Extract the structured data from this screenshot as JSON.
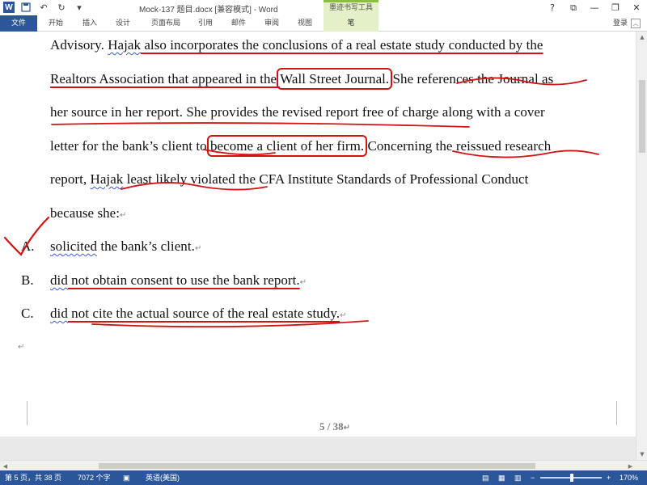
{
  "window": {
    "title": "Mock-137 题目.docx [兼容模式] - Word",
    "context_tool_title": "墨迹书写工具",
    "help": "?",
    "ribbon_display": "⧉",
    "minimize": "—",
    "restore": "❐",
    "close": "✕"
  },
  "ribbon": {
    "tabs": [
      "文件",
      "开始",
      "插入",
      "设计",
      "页面布局",
      "引用",
      "邮件",
      "审阅",
      "视图",
      "笔"
    ],
    "login": "登录",
    "collapse": "︿"
  },
  "document": {
    "lines": [
      [
        "Advisory. ",
        "Hajak",
        " also incorporates the conclusions of a real estate study conducted by the"
      ],
      [
        "Realtors Association that appeared in the ",
        "Wall Street Journal.",
        " She references the Journal as"
      ],
      [
        "her source in her report. She provides the revised report free of charge along with a cover"
      ],
      [
        "letter for the bank’s client to ",
        "become a client of her firm.",
        " Concerning the reissued research"
      ],
      [
        "report, ",
        "Hajak",
        " least likely violated the CFA Institute Standards of Professional Conduct"
      ],
      [
        "because she:"
      ]
    ],
    "para_mark": "↵",
    "options": [
      {
        "letter": "A.",
        "parts": [
          "solicited",
          " the bank’s client."
        ]
      },
      {
        "letter": "B.",
        "parts": [
          "did",
          " not obtain consent to use the bank report."
        ]
      },
      {
        "letter": "C.",
        "parts": [
          "did",
          " not cite the actual source of the real estate study."
        ]
      }
    ],
    "page_number": "5 / 38"
  },
  "status": {
    "page": "第 5 页，共 38 页",
    "words": "7072 个字",
    "language": "英语(美国)",
    "zoom": "170%",
    "zoom_out": "−",
    "zoom_in": "+"
  },
  "colors": {
    "accent": "#2b579a",
    "ink": "#d01414",
    "context_tab": "#e3f0c8"
  }
}
